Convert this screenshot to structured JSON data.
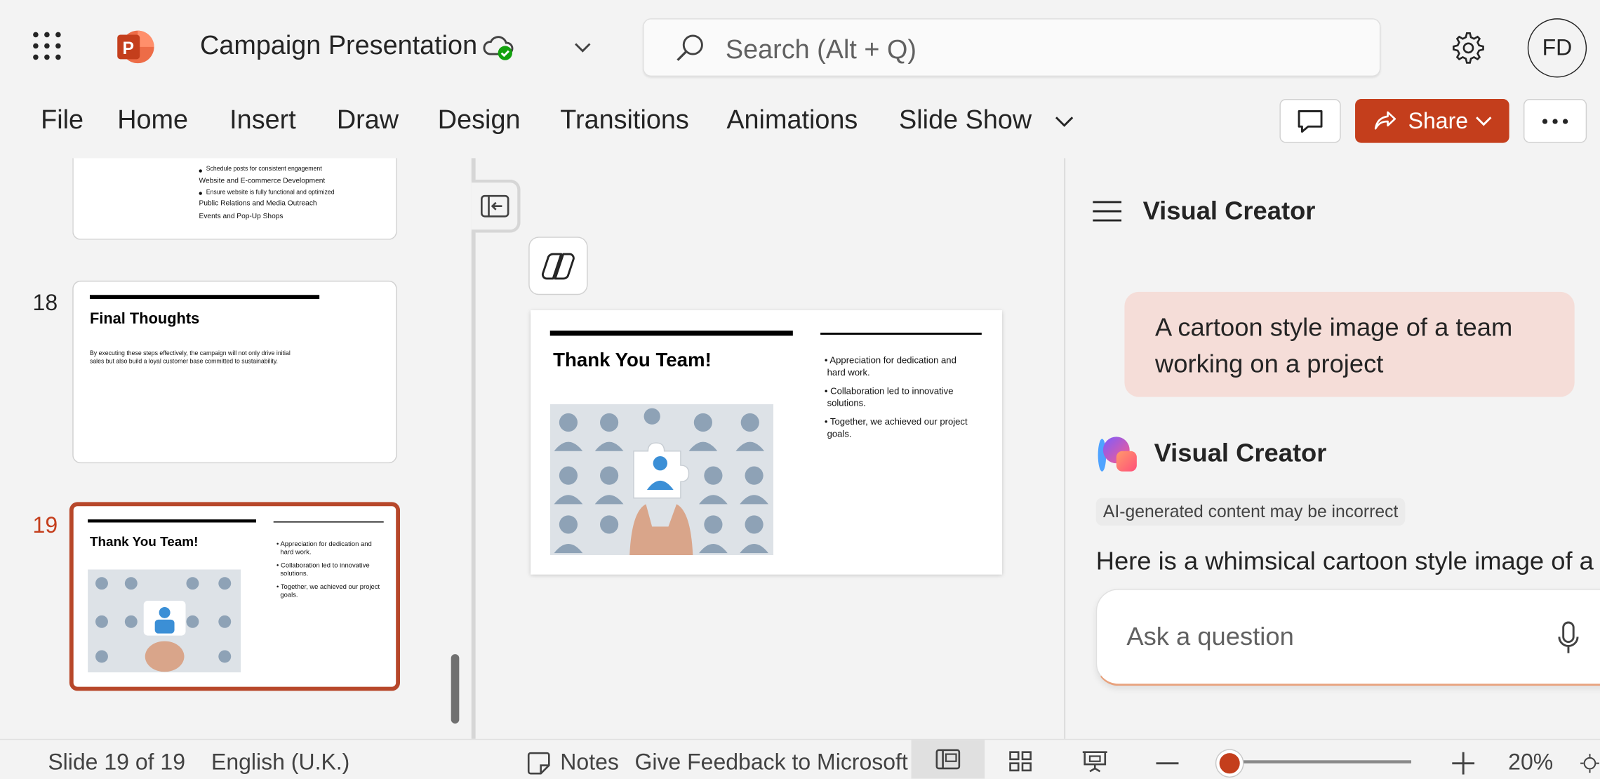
{
  "app": {
    "document_title": "Campaign Presentation",
    "user_initials": "FD"
  },
  "search": {
    "placeholder": "Search (Alt + Q)"
  },
  "ribbon": {
    "tabs": [
      "File",
      "Home",
      "Insert",
      "Draw",
      "Design",
      "Transitions",
      "Animations",
      "Slide Show"
    ],
    "share_label": "Share"
  },
  "thumbnails": {
    "slide17_lines": [
      "Schedule posts for consistent engagement",
      "Website and E-commerce Development",
      "Ensure website is fully functional and optimized",
      "Public Relations and Media Outreach",
      "Events and Pop-Up Shops"
    ],
    "slide18": {
      "number": "18",
      "title": "Final Thoughts",
      "body_line1": "By executing these steps effectively, the campaign will not only drive initial",
      "body_line2": "sales but also build a loyal customer base committed to sustainability."
    },
    "slide19": {
      "number": "19"
    }
  },
  "slide": {
    "title": "Thank You Team!",
    "bullets": [
      [
        "Appreciation for dedication and",
        "hard work."
      ],
      [
        "Collaboration led to innovative",
        "solutions."
      ],
      [
        "Together, we achieved our project",
        "goals."
      ]
    ]
  },
  "copilot": {
    "pane_title": "Visual Creator",
    "user_prompt": "A cartoon style image of a team working on a project",
    "agent_name": "Visual Creator",
    "disclaimer": "AI-generated content may be incorrect",
    "response_text": "Here is a whimsical cartoon style image of a",
    "ask_placeholder": "Ask a question"
  },
  "status_bar": {
    "slide_position": "Slide 19 of 19",
    "language": "English (U.K.)",
    "notes_label": "Notes",
    "feedback_label": "Give Feedback to Microsoft",
    "zoom_percent": "20%",
    "zoom_level": 0.2
  },
  "colors": {
    "accent": "#c43e1c",
    "prompt_bubble": "#f5ddd8",
    "background": "#f3f3f3"
  },
  "icons": [
    "app-launcher-icon",
    "powerpoint-logo-icon",
    "cloud-saved-icon",
    "search-icon",
    "settings-gear-icon",
    "comment-icon",
    "share-icon",
    "more-options-icon",
    "collapse-pane-icon",
    "copilot-icon",
    "hamburger-menu-icon",
    "visual-creator-logo-icon",
    "microphone-icon",
    "notes-icon",
    "normal-view-icon",
    "grid-view-icon",
    "presenter-view-icon"
  ]
}
